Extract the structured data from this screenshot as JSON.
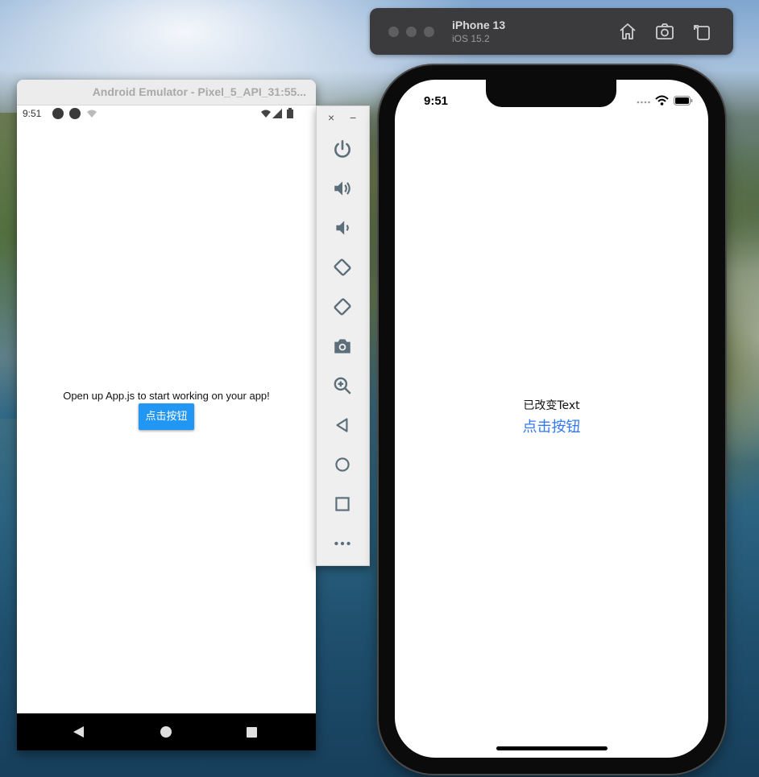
{
  "colors": {
    "android_button": "#2196f3",
    "ios_link": "#3478f6",
    "toolbar_bg": "#3b3b3d"
  },
  "ios_toolbar": {
    "device_name": "iPhone 13",
    "os_version": "iOS 15.2",
    "icons": [
      "home-icon",
      "screenshot-icon",
      "rotate-icon"
    ]
  },
  "android": {
    "window_title": "Android Emulator - Pixel_5_API_31:55...",
    "status": {
      "time": "9:51"
    },
    "app": {
      "message": "Open up App.js to start working on your app!",
      "button_label": "点击按钮"
    },
    "nav_icons": [
      "back-icon",
      "home-icon",
      "recents-icon"
    ]
  },
  "emulator_panel": {
    "close": "×",
    "minimize": "−",
    "controls": [
      "power",
      "volume-up",
      "volume-down",
      "rotate-left",
      "rotate-right",
      "camera",
      "zoom",
      "back",
      "home",
      "overview",
      "more"
    ]
  },
  "iphone": {
    "status": {
      "time": "9:51"
    },
    "app": {
      "message": "已改变Text",
      "button_label": "点击按钮"
    }
  }
}
